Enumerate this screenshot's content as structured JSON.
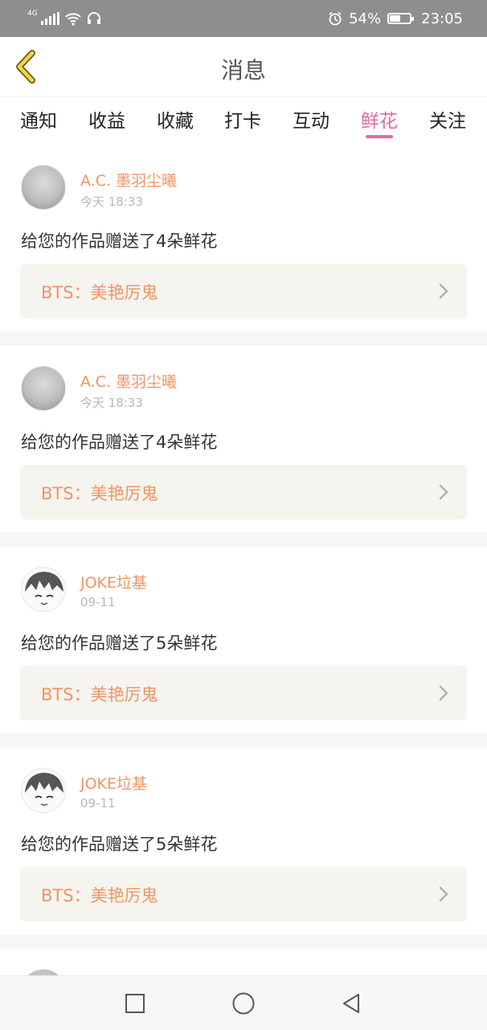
{
  "status_bar": {
    "network": "4G",
    "signal_icon": "signal-icon",
    "wifi_icon": "wifi-icon",
    "headset_icon": "headset-icon",
    "alarm_icon": "alarm-icon",
    "battery_percent": "54%",
    "battery_level": 0.54,
    "time": "23:05"
  },
  "header": {
    "title": "消息",
    "back_icon": "chevron-left-icon"
  },
  "tabs": [
    {
      "label": "通知",
      "active": false
    },
    {
      "label": "收益",
      "active": false
    },
    {
      "label": "收藏",
      "active": false
    },
    {
      "label": "打卡",
      "active": false
    },
    {
      "label": "互动",
      "active": false
    },
    {
      "label": "鲜花",
      "active": true
    },
    {
      "label": "关注",
      "active": false
    }
  ],
  "colors": {
    "accent_pink": "#e36a9d",
    "name_orange": "#ef9466",
    "work_bg": "#f5f4ee"
  },
  "messages": [
    {
      "user": "A.C. 墨羽尘曦",
      "time": "今天 18:33",
      "text": "给您的作品赠送了4朵鲜花",
      "work": "BTS：美艳厉鬼"
    },
    {
      "user": "A.C. 墨羽尘曦",
      "time": "今天 18:33",
      "text": "给您的作品赠送了4朵鲜花",
      "work": "BTS：美艳厉鬼"
    },
    {
      "user": "JOKE垃基",
      "time": "09-11",
      "text": "给您的作品赠送了5朵鲜花",
      "work": "BTS：美艳厉鬼"
    },
    {
      "user": "JOKE垃基",
      "time": "09-11",
      "text": "给您的作品赠送了5朵鲜花",
      "work": "BTS：美艳厉鬼"
    }
  ],
  "nav_bar": {
    "recent_icon": "square-icon",
    "home_icon": "circle-icon",
    "back_icon": "triangle-back-icon"
  }
}
